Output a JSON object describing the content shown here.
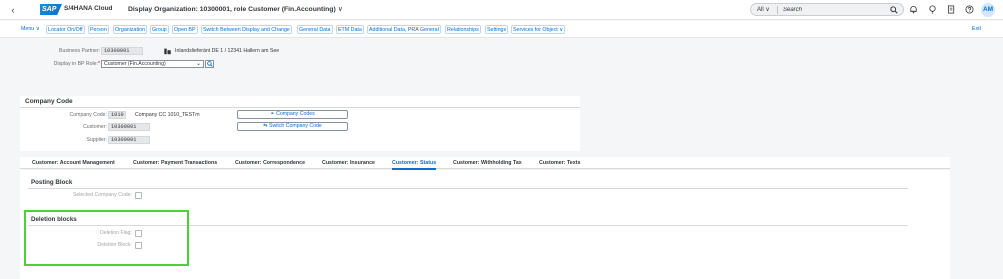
{
  "shell": {
    "logo_text": "SAP",
    "product": "S/4HANA Cloud",
    "title": "Display Organization: 10300001, role Customer (Fin.Accounting)",
    "title_chevron": "∨",
    "search": {
      "scope": "All",
      "scope_chevron": "∨",
      "placeholder": "Search"
    },
    "user_initials": "AM",
    "icons": [
      "back-icon",
      "search-icon",
      "bell-icon",
      "lightbulb-icon",
      "notes-icon",
      "help-icon"
    ]
  },
  "toolbar": {
    "items": [
      "Menu ∨",
      "Locator On/Off",
      "Person",
      "Organization",
      "Group",
      "Open BP",
      "Switch Between Display and Change",
      "General Data",
      "ETM Data",
      "Additional Data, PRA General",
      "Relationships",
      "Settings",
      "Services for Object ∨"
    ],
    "exit_label": "Exit"
  },
  "header_form": {
    "bp_label": "Business Partner:",
    "bp_value": "10300001",
    "bp_address": "Inlandslieferänt DE 1 / 12341 Hallern am See",
    "role_label": "Display in BP Role:",
    "role_required": "*",
    "role_value": "Customer (Fin.Accounting)"
  },
  "company_code_panel": {
    "title": "Company Code",
    "company_code_label": "Company Code:",
    "company_code_value": "1010",
    "company_code_desc": "Company CC 1010_TESTm",
    "customer_label": "Customer:",
    "customer_value": "10300001",
    "supplier_label": "Supplier:",
    "supplier_value": "10300001",
    "company_codes_button": "Company Codes",
    "switch_company_code_button": "Switch Company Code"
  },
  "tabs": [
    {
      "label": "Customer: Account Management",
      "active": false
    },
    {
      "label": "Customer: Payment Transactions",
      "active": false
    },
    {
      "label": "Customer: Correspondence",
      "active": false
    },
    {
      "label": "Customer: Insurance",
      "active": false
    },
    {
      "label": "Customer: Status",
      "active": true
    },
    {
      "label": "Customer: Withholding Tax",
      "active": false
    },
    {
      "label": "Customer: Texts",
      "active": false
    }
  ],
  "posting_block": {
    "title": "Posting Block",
    "selected_company_code_label": "Selected Company Code:",
    "selected_company_code_checked": false
  },
  "deletion_blocks": {
    "title": "Deletion blocks",
    "deletion_flag_label": "Deletion Flag:",
    "deletion_flag_checked": false,
    "deletion_block_label": "Deletion Block:",
    "deletion_block_checked": false
  },
  "colors": {
    "accent": "#0a6ed1",
    "highlight": "#4cd137"
  }
}
